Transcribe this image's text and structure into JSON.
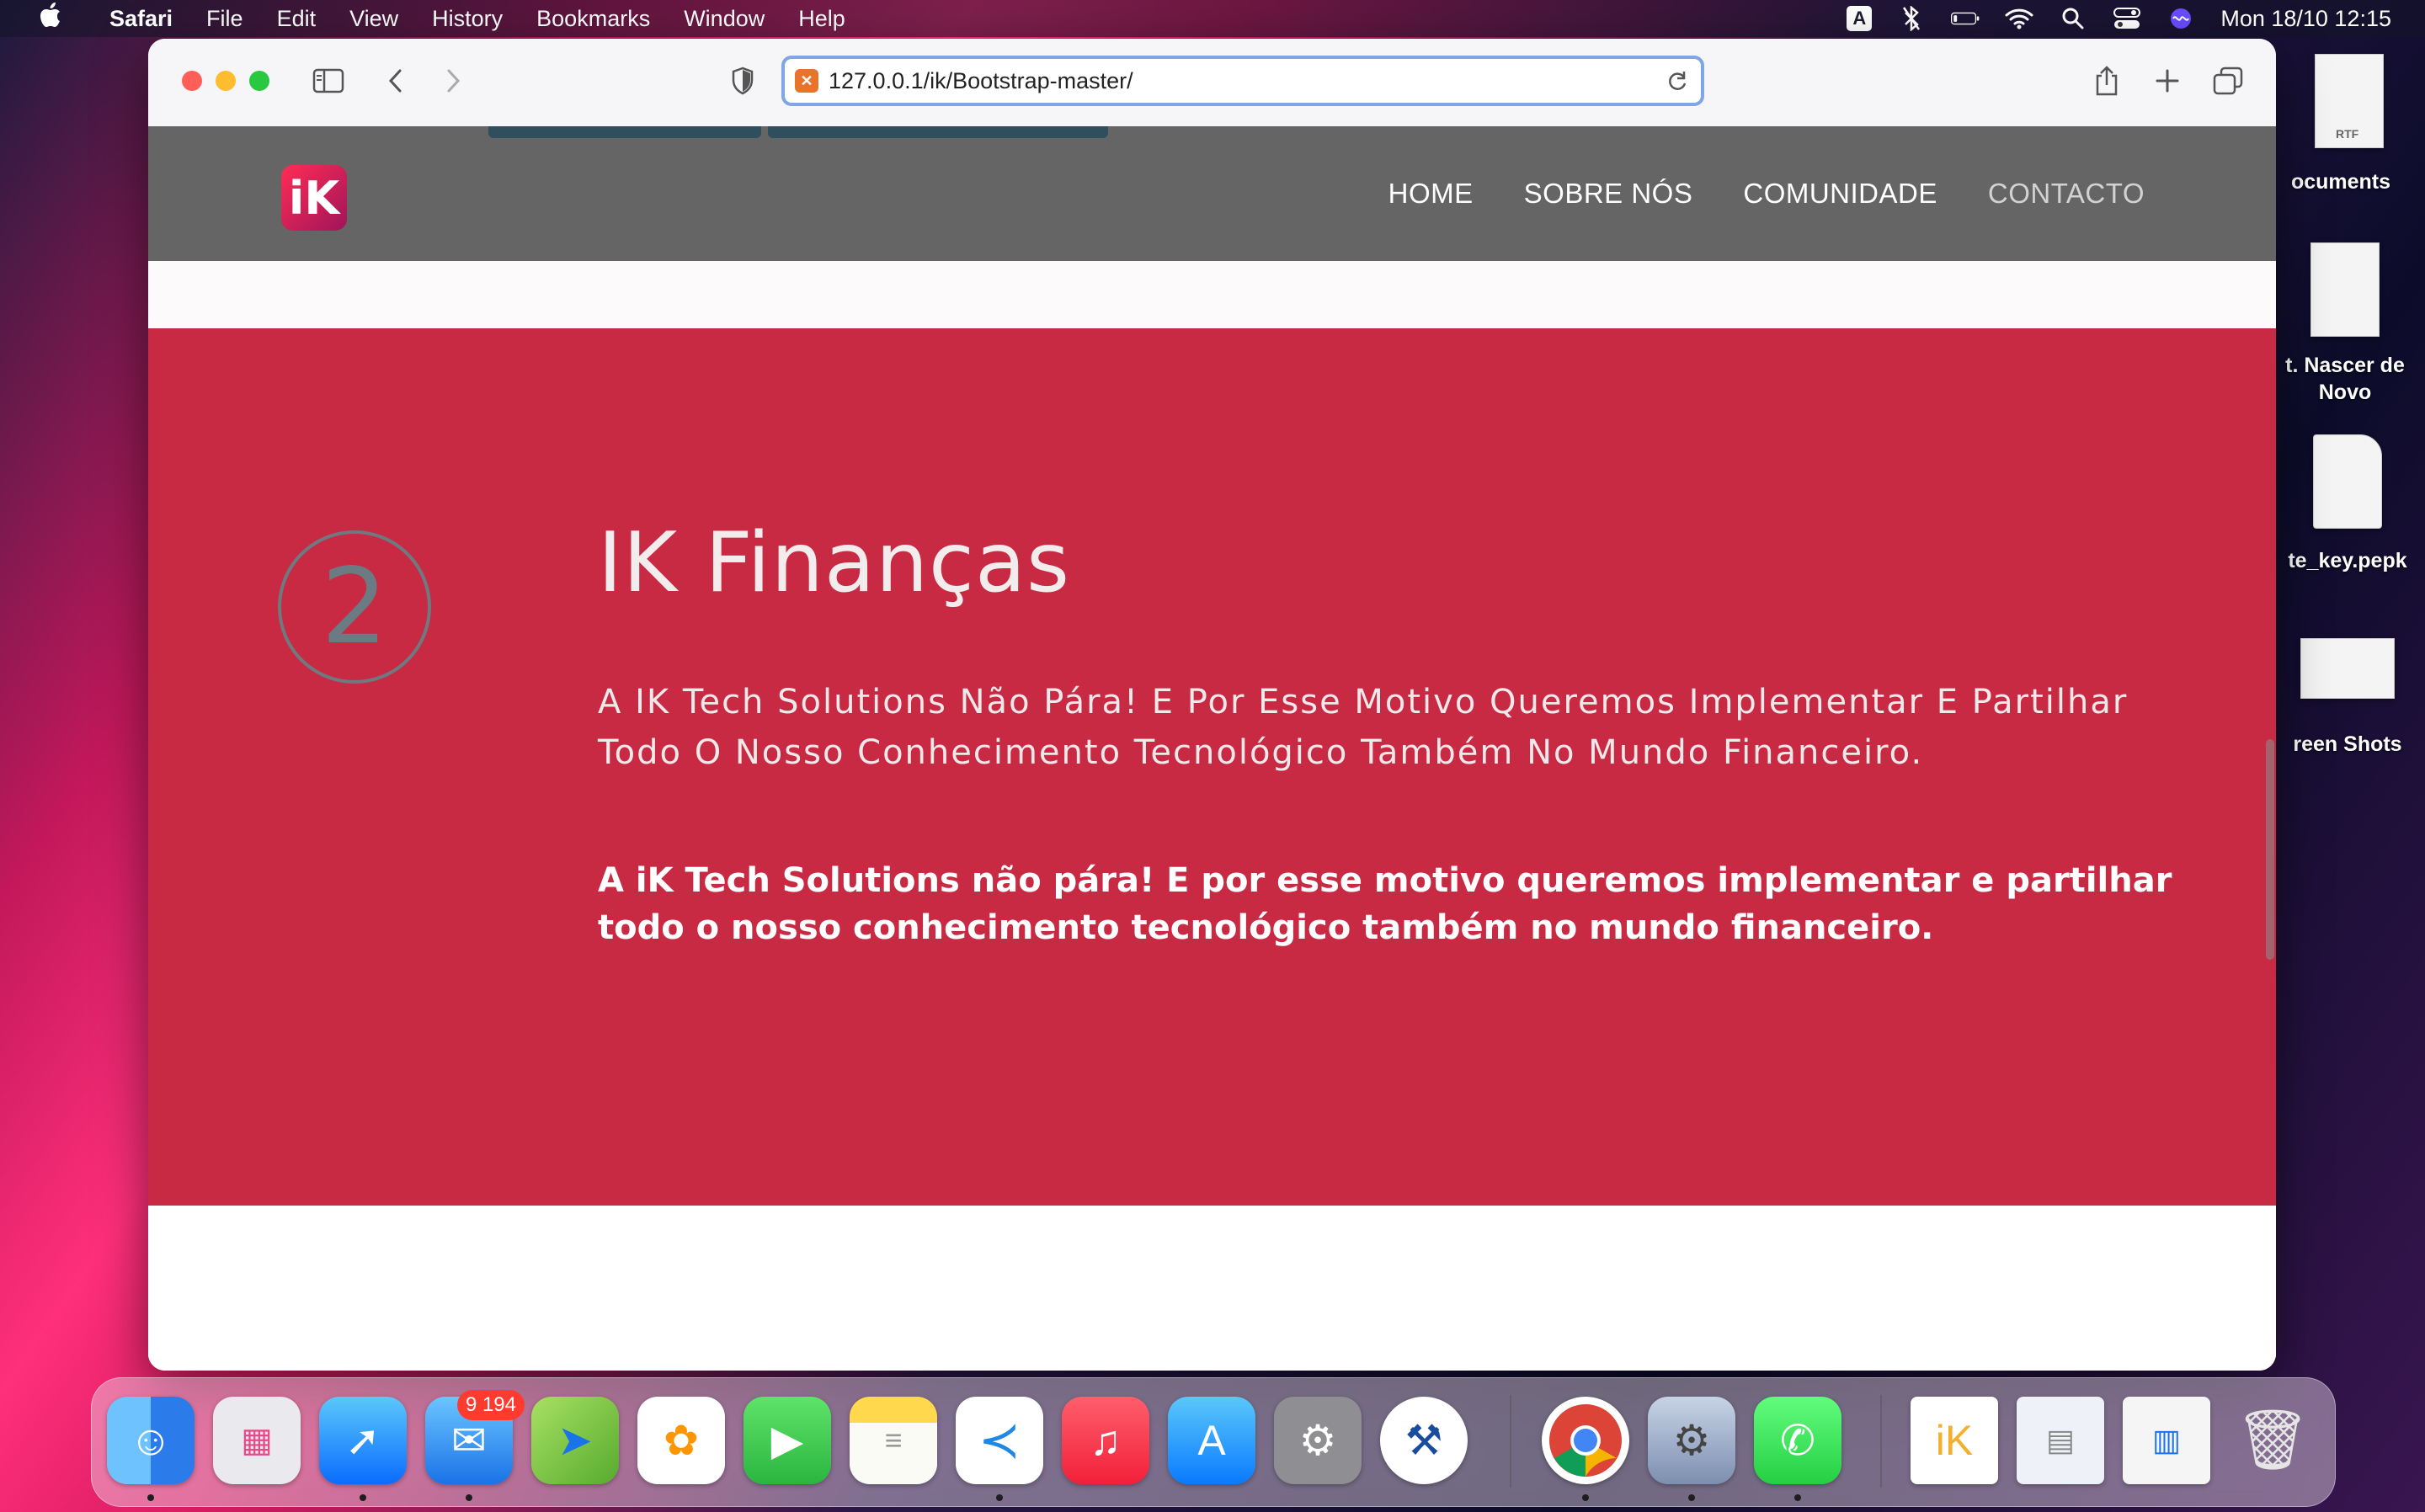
{
  "menubar": {
    "app_name": "Safari",
    "items": [
      "File",
      "Edit",
      "View",
      "History",
      "Bookmarks",
      "Window",
      "Help"
    ],
    "input_source": "A",
    "clock": "Mon 18/10  12:15"
  },
  "desktop": {
    "items": [
      {
        "label": "ocuments",
        "thumb_label": "RTF"
      },
      {
        "label": "t. Nascer de Novo"
      },
      {
        "label": "te_key.pepk"
      },
      {
        "label": "reen Shots"
      }
    ]
  },
  "browser": {
    "url": "127.0.0.1/ik/Bootstrap-master/"
  },
  "site": {
    "logo_text": "iK",
    "nav": [
      "HOME",
      "SOBRE NÓS",
      "COMUNIDADE",
      "CONTACTO"
    ],
    "section": {
      "number": "2",
      "title": "IK Finanças",
      "subtitle": "A IK Tech Solutions Não Pára! E Por Esse Motivo Queremos Implementar E Partilhar Todo O Nosso Conhecimento Tecnológico Também No Mundo Financeiro.",
      "body": "A iK Tech Solutions não pára! E por esse motivo queremos implementar e partilhar todo o nosso conhecimento tecnológico também no mundo financeiro."
    },
    "colors": {
      "navbar": "#656565",
      "section": "#c82a43"
    }
  },
  "dock": {
    "mail_badge": "9 194",
    "apps": [
      "Finder",
      "Launchpad",
      "Safari",
      "Mail",
      "Maps",
      "Photos",
      "FaceTime",
      "Notes",
      "Visual Studio Code",
      "Music",
      "App Store",
      "System Preferences",
      "Xcode Instruments",
      "Chrome",
      "Settings",
      "WhatsApp",
      "Trash"
    ]
  }
}
